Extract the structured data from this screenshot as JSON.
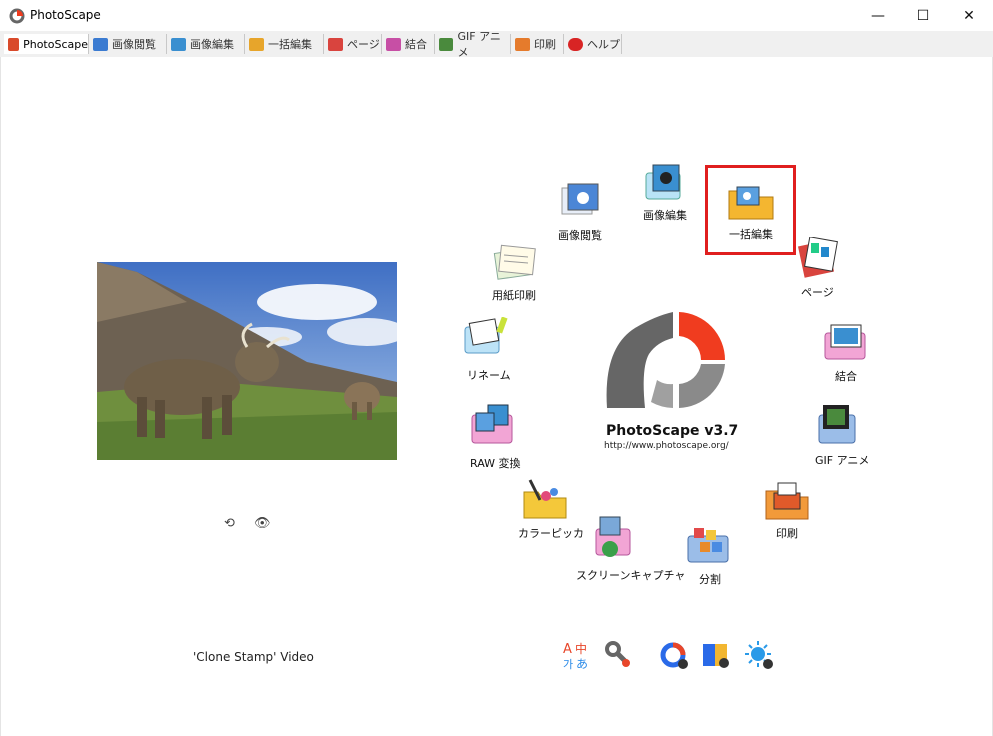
{
  "window": {
    "title": "PhotoScape",
    "controls": {
      "minimize": "—",
      "maximize": "☐",
      "close": "✕"
    }
  },
  "tabs": [
    {
      "label": "PhotoScape",
      "icon": "photoscape-icon",
      "color": "#d94a2b"
    },
    {
      "label": "画像閲覧",
      "icon": "viewer-icon",
      "color": "#3b7bd1"
    },
    {
      "label": "画像編集",
      "icon": "editor-icon",
      "color": "#3a8fd0"
    },
    {
      "label": "一括編集",
      "icon": "batch-icon",
      "color": "#e7a52b"
    },
    {
      "label": "ページ",
      "icon": "page-icon",
      "color": "#d9443e"
    },
    {
      "label": "結合",
      "icon": "combine-icon",
      "color": "#c74fa5"
    },
    {
      "label": "GIF アニメ",
      "icon": "gif-icon",
      "color": "#4a8a3d"
    },
    {
      "label": "印刷",
      "icon": "print-icon",
      "color": "#e57b2c"
    },
    {
      "label": "ヘルプ",
      "icon": "help-icon",
      "color": "#d82424"
    }
  ],
  "left": {
    "caption": "'Clone Stamp' Video"
  },
  "brand": {
    "name": "PhotoScape v3.7",
    "url": "http://www.photoscape.org/"
  },
  "launchers": {
    "viewer": "画像閲覧",
    "editor": "画像編集",
    "batch": "一括編集",
    "page": "ページ",
    "paper": "用紙印刷",
    "combine": "結合",
    "rename": "リネーム",
    "gif": "GIF アニメ",
    "raw": "RAW 変換",
    "colorpicker": "カラーピッカ",
    "print": "印刷",
    "capture": "スクリーンキャプチャ",
    "split": "分割"
  },
  "bottom_icons": [
    "language-icon",
    "tools-icon",
    "photoscape-x-icon",
    "photoscape-x-mac-icon",
    "brightness-icon"
  ],
  "colors": {
    "highlight": "#e01f1f",
    "accent_red": "#f03c1f",
    "logo_gray": "#6b6b6b"
  }
}
